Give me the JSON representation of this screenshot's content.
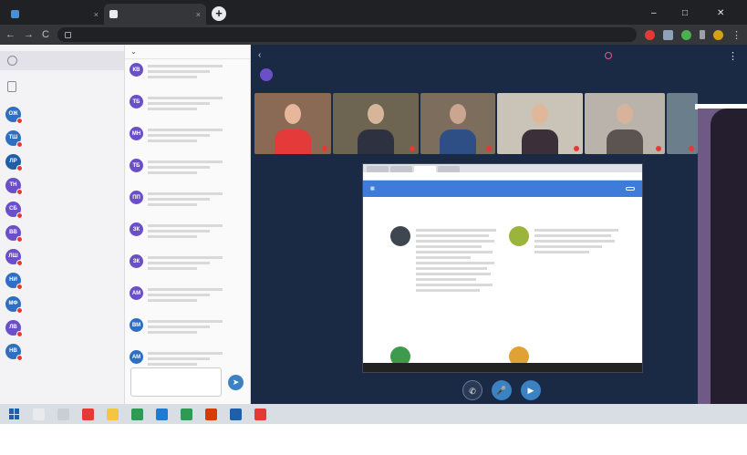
{
  "browser": {
    "tabs": [
      {
        "label": "",
        "color": "#4a8fd6"
      },
      {
        "label": "",
        "color": "#e8eaed"
      }
    ],
    "tab_close": "×",
    "new_tab": "+",
    "window_controls": {
      "minimize": "–",
      "maximize": "□",
      "close": "✕"
    },
    "nav": {
      "back": "←",
      "forward": "→",
      "reload": "C"
    },
    "url_domain": "",
    "url_title": "",
    "menu": "⋮"
  },
  "sidebar": {
    "section1": "",
    "files_label": "",
    "section2": "",
    "notes_label": "",
    "section3": "",
    "participants": [
      {
        "initials": "ОЖ",
        "name": "",
        "color": "#2f6fc2"
      },
      {
        "initials": "ТШ",
        "name": "",
        "color": "#2f6fc2"
      },
      {
        "initials": "ЛР",
        "name": "",
        "color": "#1f5fa8"
      },
      {
        "initials": "ТН",
        "name": "",
        "color": "#6b4fc9"
      },
      {
        "initials": "СБ",
        "name": "",
        "color": "#6b4fc9"
      },
      {
        "initials": "ВВ",
        "name": "",
        "color": "#6b4fc9"
      },
      {
        "initials": "ЛШ",
        "name": "",
        "color": "#6b4fc9"
      },
      {
        "initials": "НИ",
        "name": "",
        "color": "#2f6fc2"
      },
      {
        "initials": "МФ",
        "name": "",
        "color": "#2f6fc2"
      },
      {
        "initials": "ЛВ",
        "name": "",
        "color": "#6b4fc9"
      },
      {
        "initials": "НВ",
        "name": "",
        "color": "#2f6fc2"
      }
    ]
  },
  "chat": {
    "header": "",
    "messages": [
      {
        "initials": "КВ",
        "author": "",
        "time": "",
        "text": "",
        "color": "#6b4fc9"
      },
      {
        "initials": "ТБ",
        "author": "",
        "time": "",
        "text": "",
        "color": "#6b4fc9"
      },
      {
        "initials": "МН",
        "author": "",
        "time": "",
        "text": "",
        "color": "#6b4fc9"
      },
      {
        "initials": "ТБ",
        "author": "",
        "time": "",
        "text": "",
        "color": "#6b4fc9"
      },
      {
        "initials": "ПП",
        "author": "",
        "time": "",
        "text": "",
        "color": "#6b4fc9"
      },
      {
        "initials": "ЗК",
        "author": "",
        "time": "",
        "text": "",
        "color": "#6b4fc9"
      },
      {
        "initials": "ЗК",
        "author": "",
        "time": "",
        "text": "",
        "color": "#6b4fc9"
      },
      {
        "initials": "АМ",
        "author": "",
        "time": "",
        "text": "",
        "color": "#6b4fc9"
      },
      {
        "initials": "ВМ",
        "author": "",
        "time": "",
        "text": "",
        "color": "#2f6fc2"
      },
      {
        "initials": "АМ",
        "author": "",
        "time": "",
        "text": "",
        "color": "#2f6fc2"
      }
    ],
    "input_placeholder": "",
    "send_icon": "➤"
  },
  "meeting": {
    "back_icon": "‹",
    "title": "",
    "timer": "",
    "menu_icon": "⋮",
    "chip_label": "",
    "videos": [
      {
        "name": "",
        "bg": "#8a6a54",
        "shirt": "#e43a3a",
        "skin": "#e7b79c"
      },
      {
        "name": "",
        "bg": "#6d6552",
        "shirt": "#2e3240",
        "skin": "#d7b59a"
      },
      {
        "name": "",
        "bg": "#7c6d5d",
        "shirt": "#2d4f86",
        "skin": "#caa690"
      },
      {
        "name": "",
        "bg": "#c9c3b8",
        "shirt": "#3b2f3a",
        "skin": "#e1b79c"
      },
      {
        "name": "",
        "bg": "#b9b3ac",
        "shirt": "#5c5450",
        "skin": "#d8b39b"
      },
      {
        "name": "",
        "bg": "#6a7e8c",
        "shirt": "#6a7e8c",
        "skin": "#6a7e8c"
      }
    ],
    "share": {
      "heading": "",
      "button": "",
      "left_col": {
        "title": ""
      },
      "right_col": {
        "title": ""
      }
    },
    "controls": {
      "leave_icon": "✆",
      "mic_icon": "🎤",
      "cam_icon": "▶"
    }
  },
  "taskbar": {
    "icons": [
      {
        "name": "search-icon",
        "color": "#e8eaed"
      },
      {
        "name": "taskview-icon",
        "color": "#c9ced6"
      },
      {
        "name": "yandex-icon",
        "color": "#e53935"
      },
      {
        "name": "files-icon",
        "color": "#f5c542"
      },
      {
        "name": "chrome-icon",
        "color": "#2e9a53"
      },
      {
        "name": "edge-icon",
        "color": "#1f7ad1"
      },
      {
        "name": "chrome2-icon",
        "color": "#2e9a53"
      },
      {
        "name": "office-icon",
        "color": "#d83b01"
      },
      {
        "name": "app-icon",
        "color": "#1f5fa8"
      },
      {
        "name": "yandex2-icon",
        "color": "#e53935"
      }
    ],
    "tray": ""
  }
}
